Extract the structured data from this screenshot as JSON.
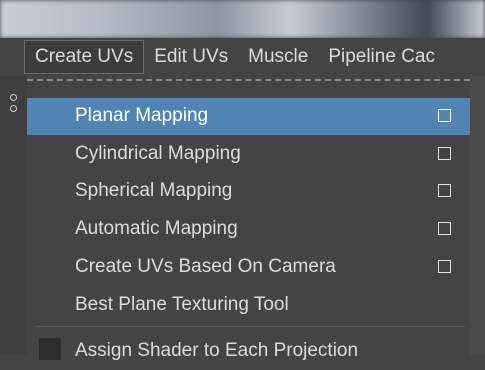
{
  "menubar": {
    "items": [
      "Create UVs",
      "Edit UVs",
      "Muscle",
      "Pipeline Cac"
    ]
  },
  "dropdown": {
    "items": [
      {
        "label": "Planar Mapping",
        "highlighted": true,
        "has_option_box": true
      },
      {
        "label": "Cylindrical Mapping",
        "has_option_box": true
      },
      {
        "label": "Spherical Mapping",
        "has_option_box": true
      },
      {
        "label": "Automatic Mapping",
        "has_option_box": true
      },
      {
        "label": "Create UVs Based On Camera",
        "has_option_box": true
      },
      {
        "label": "Best Plane Texturing Tool",
        "has_option_box": false
      }
    ],
    "check_item": {
      "label": "Assign Shader to Each Projection"
    }
  },
  "colors": {
    "highlight": "#5284b3",
    "background": "#444444",
    "text": "#dcdcdc"
  }
}
